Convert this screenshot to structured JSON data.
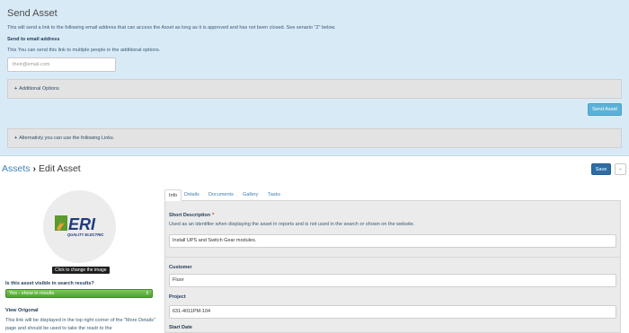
{
  "send_asset": {
    "title": "Send Asset",
    "description": "This will send a link to the following email address that can access the Asset as long as it is approved and has not been closed. See senario \"2\" below.",
    "email_label": "Send to email address",
    "email_sublabel": "This You can send this link to multiple people in the additional options.",
    "email_placeholder": "their@email.com",
    "email_value": "",
    "additional_options": "Additional Options",
    "send_button": "Send Asset",
    "alternative_links": "Alternativly you can use the following Links."
  },
  "breadcrumb": {
    "parent": "Assets",
    "separator": "›",
    "current": "Edit Asset"
  },
  "toolbar": {
    "save_label": "Save",
    "more_label": "⌄"
  },
  "left": {
    "logo_text": "ERI",
    "logo_sub": "QUALITY ELECTRIC",
    "image_tooltip": "Click to change the image",
    "visibility_label": "Is this asset visible in search results?",
    "visibility_value": "Yes - show in results",
    "view_original_label": "View Origonal",
    "view_original_desc": "This link will be displayed in the top right corner of the \"More Details\" page and should be used to take the readr to the"
  },
  "tabs": [
    "Info",
    "Details",
    "Documents",
    "Gallery",
    "Tasks"
  ],
  "form": {
    "short_description": {
      "label": "Short Description",
      "required_mark": "*",
      "help": "Used as an identifier when displaying the asset in reports and is not used in the search or shown on the website.",
      "value": "Install UPS and Switch Gear modules."
    },
    "customer": {
      "label": "Customer",
      "value": "Fluor"
    },
    "project": {
      "label": "Project",
      "value": "631-4011PM-104"
    },
    "start_date": {
      "label": "Start Date"
    }
  },
  "colors": {
    "panel_bg": "#d9eaf7",
    "link": "#3f7fb5",
    "save_button": "#2e6da4",
    "send_button": "#5bb1d8",
    "visibility_select": "#4fa233",
    "required": "#d0281c"
  }
}
